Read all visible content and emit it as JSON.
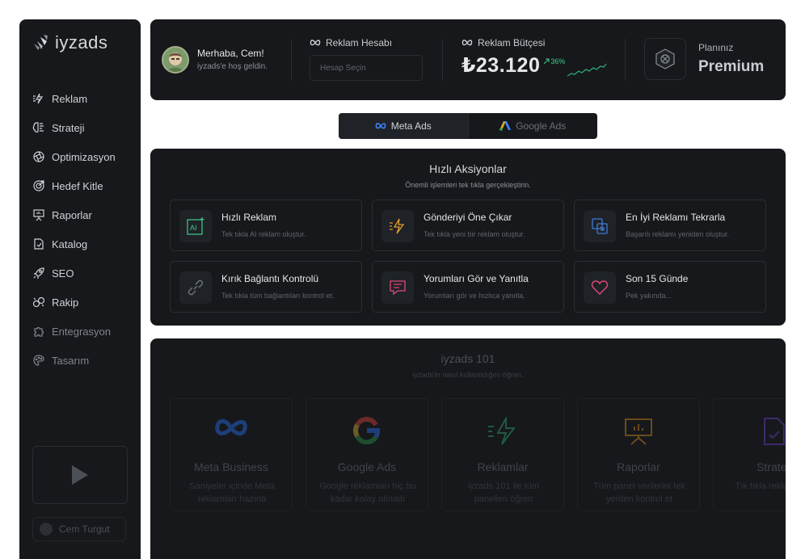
{
  "app": {
    "logo_text": "iyzads"
  },
  "sidebar": {
    "items": [
      {
        "label": "Reklam",
        "icon": "lightning-icon"
      },
      {
        "label": "Strateji",
        "icon": "brain-icon"
      },
      {
        "label": "Optimizasyon",
        "icon": "aperture-icon"
      },
      {
        "label": "Hedef Kitle",
        "icon": "target-icon"
      },
      {
        "label": "Raporlar",
        "icon": "presentation-icon"
      },
      {
        "label": "Katalog",
        "icon": "catalog-icon"
      },
      {
        "label": "SEO",
        "icon": "rocket-icon"
      },
      {
        "label": "Rakip",
        "icon": "competitor-icon"
      },
      {
        "label": "Entegrasyon",
        "icon": "puzzle-icon"
      },
      {
        "label": "Tasarım",
        "icon": "palette-icon"
      }
    ],
    "user_name": "Cem Turgut"
  },
  "header": {
    "greeting": "Merhaba, Cem!",
    "welcome": "iyzads'e hoş geldin.",
    "account_label": "Reklam Hesabı",
    "account_placeholder": "Hesap Seçin",
    "budget_label": "Reklam Bütçesi",
    "budget_value": "₺23.120",
    "budget_change": "36%",
    "plan_label": "Planınız",
    "plan_value": "Premium"
  },
  "platform_tabs": [
    {
      "label": "Meta Ads",
      "active": true
    },
    {
      "label": "Google Ads",
      "active": false
    }
  ],
  "quick_actions": {
    "title": "Hızlı Aksiyonlar",
    "subtitle": "Önemli işlemleri tek tıkla gerçekleştirin.",
    "items": [
      {
        "title": "Hızlı Reklam",
        "desc": "Tek tıkla AI reklam oluştur.",
        "icon": "ai-icon",
        "color": "#3ecb8a"
      },
      {
        "title": "Gönderiyi Öne Çıkar",
        "desc": "Tek tıkla yeni bir reklam oluştur.",
        "icon": "boost-icon",
        "color": "#e39a2e"
      },
      {
        "title": "En İyi Reklamı Tekrarla",
        "desc": "Başarılı reklamı yeniden oluştur.",
        "icon": "copy-icon",
        "color": "#3f7bd9"
      },
      {
        "title": "Kırık Bağlantı Kontrolü",
        "desc": "Tek tıkla tüm bağlantıları kontrol et.",
        "icon": "link-icon",
        "color": "#5f656c"
      },
      {
        "title": "Yorumları Gör ve Yanıtla",
        "desc": "Yorumları gör ve hızlıca yanıtla.",
        "icon": "comment-icon",
        "color": "#e0477a"
      },
      {
        "title": "Son 15 Günde",
        "desc": "Pek yakında...",
        "icon": "heart-icon",
        "color": "#e0477a"
      }
    ]
  },
  "learn": {
    "title": "iyzads 101",
    "subtitle": "iyzads'in nasıl kullanıldığını öğren.",
    "cards": [
      {
        "title": "Meta Business",
        "desc": "Saniyeler içinde Meta reklamları hazırla",
        "icon": "meta-icon"
      },
      {
        "title": "Google Ads",
        "desc": "Google reklamları hiç bu kadar kolay olmadı",
        "icon": "google-icon"
      },
      {
        "title": "Reklamlar",
        "desc": "iyzads 101 ile tüm panelleri öğren",
        "icon": "lightning-icon"
      },
      {
        "title": "Raporlar",
        "desc": "Tüm panel verilerini tek yerden kontrol et",
        "icon": "presentation-icon"
      },
      {
        "title": "Strateji",
        "desc": "Tık tıkla reklamlarını",
        "icon": "document-icon"
      }
    ]
  }
}
